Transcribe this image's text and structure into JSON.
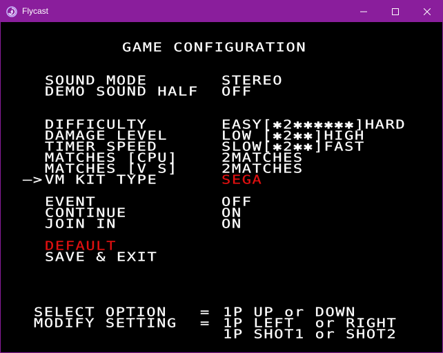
{
  "window": {
    "title": "Flycast",
    "accent_color": "#8a1e9c",
    "icons": {
      "app": "flycast-swirl-icon",
      "minimize": "minimize-icon",
      "maximize": "maximize-icon",
      "close": "close-icon"
    }
  },
  "screen": {
    "title": "GAME CONFIGURATION",
    "highlight_color": "#e01010",
    "sound": [
      {
        "label": "SOUND MODE",
        "value": "STEREO"
      },
      {
        "label": "DEMO SOUND HALF",
        "value": "OFF"
      }
    ],
    "game": [
      {
        "label": "DIFFICULTY",
        "value": "EASY[✱2✱✱✱✱✱✱]HARD"
      },
      {
        "label": "DAMAGE LEVEL",
        "value": "LOW [✱2✱✱]HIGH"
      },
      {
        "label": "TIMER SPEED",
        "value": "SLOW[✱2✱✱]FAST"
      },
      {
        "label": "MATCHES [CPU]",
        "value": "2MATCHES"
      },
      {
        "label": "MATCHES [V S]",
        "value": "2MATCHES"
      },
      {
        "label": "VM KIT TYPE",
        "value": "SEGA",
        "cursor": "—>"
      }
    ],
    "misc": [
      {
        "label": "EVENT",
        "value": "OFF"
      },
      {
        "label": "CONTINUE",
        "value": "ON"
      },
      {
        "label": "JOIN IN",
        "value": "ON"
      }
    ],
    "actions": {
      "default": "DEFAULT",
      "save_exit": "SAVE & EXIT"
    },
    "help": {
      "select_label": "SELECT OPTION",
      "modify_label": "MODIFY SETTING",
      "equals": "=",
      "select_value": "1P UP or DOWN",
      "modify_value_1": "1P LEFT  or RIGHT",
      "modify_value_2": "1P SHOT1 or SHOT2"
    }
  }
}
